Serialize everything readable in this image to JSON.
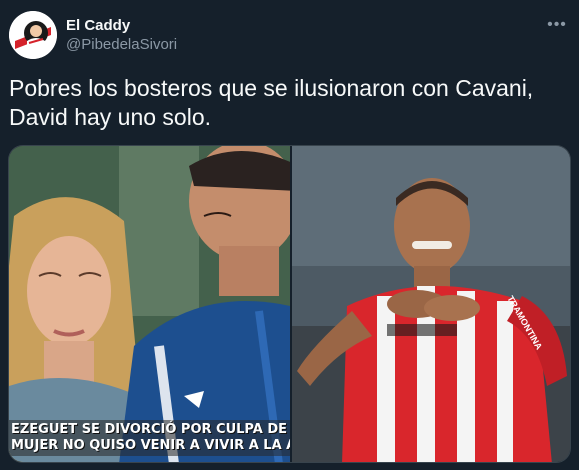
{
  "tweet": {
    "display_name": "El Caddy",
    "handle": "@PibedelaSivori",
    "more_icon": "more-horizontal-icon",
    "text_lines": [
      "Pobres los bosteros que se ilusionaron con Cavani,",
      "David hay uno solo."
    ]
  },
  "media": {
    "left_caption_lines": [
      "EZEGUET SE DIVORCIÓ POR CULPA DE F",
      "MUJER NO QUISO VENIR A VIVIR A LA ARGE"
    ],
    "right_shirt_text": "TRAMONTINA"
  },
  "colors": {
    "background": "#15202b",
    "primary_text": "#f7f9f9",
    "secondary_text": "#8b98a5",
    "border": "#38444d"
  }
}
